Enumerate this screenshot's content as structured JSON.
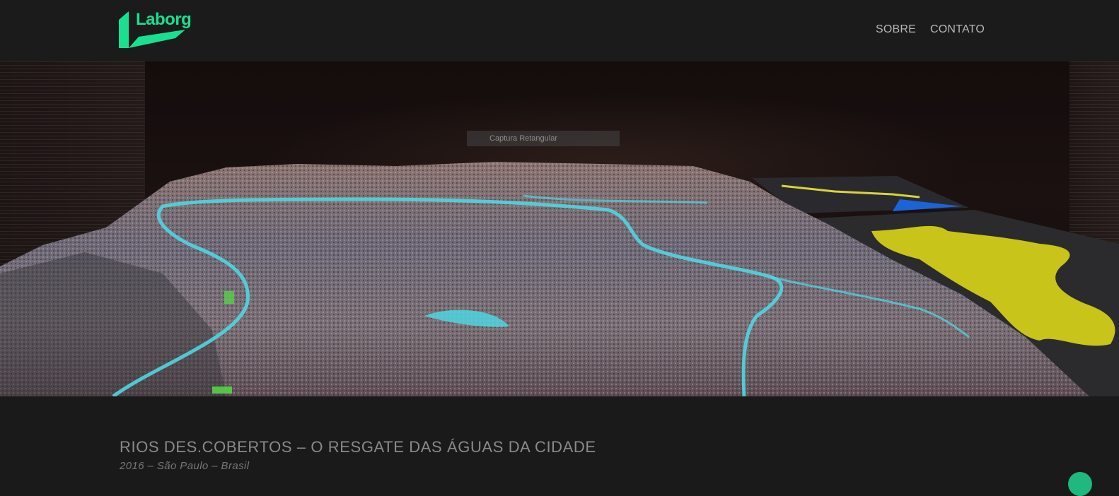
{
  "brand": {
    "name": "Laborg",
    "color": "#19e090"
  },
  "nav": {
    "items": [
      {
        "label": "SOBRE"
      },
      {
        "label": "CONTATO"
      }
    ]
  },
  "hero": {
    "image_alt": "Rios Des.cobertos 3D city model",
    "overlay_label": "Captura Retangular"
  },
  "project": {
    "title": "RIOS DES.COBERTOS – O RESGATE DAS ÁGUAS DA CIDADE",
    "meta": "2016 – São Paulo – Brasil"
  },
  "colors": {
    "background": "#1a1a1a",
    "header": "#1b1b1b",
    "nav_text": "#b7b7b7",
    "title_text": "#8a8a8a",
    "accent": "#1fb87e",
    "river": "#4fd6e0",
    "highlight": "#d4d41a"
  },
  "icons": {
    "logo": "laborg-logo-icon",
    "scroll": "scroll-up-icon"
  }
}
